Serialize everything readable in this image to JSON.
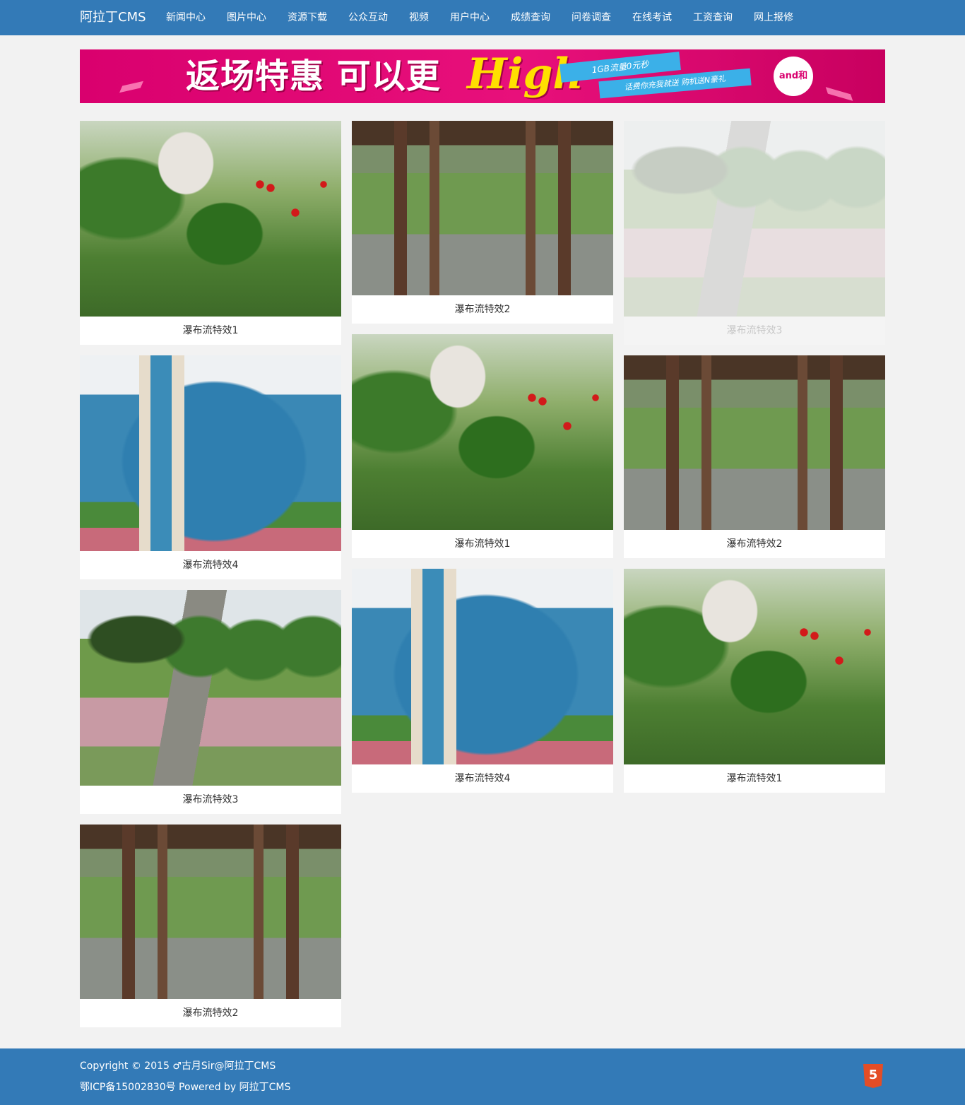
{
  "navbar": {
    "brand": "阿拉丁CMS",
    "items": [
      {
        "label": "新闻中心"
      },
      {
        "label": "图片中心"
      },
      {
        "label": "资源下载"
      },
      {
        "label": "公众互动"
      },
      {
        "label": "视频"
      },
      {
        "label": "用户中心"
      },
      {
        "label": "成绩查询"
      },
      {
        "label": "问卷调查"
      },
      {
        "label": "在线考试"
      },
      {
        "label": "工资查询"
      },
      {
        "label": "网上报修"
      }
    ]
  },
  "banner": {
    "headline": "返场特惠 可以更",
    "script_text": "High",
    "ribbon_top": "1GB流量0元秒",
    "ribbon_bottom": "话费你充我就送    购机送N豪礼",
    "logo_text": "and和"
  },
  "gallery": [
    {
      "caption": "瀑布流特效1",
      "scene": "rock"
    },
    {
      "caption": "瀑布流特效2",
      "scene": "corridor"
    },
    {
      "caption": "瀑布流特效3",
      "scene": "path",
      "faded": true
    },
    {
      "caption": "瀑布流特效4",
      "scene": "library"
    },
    {
      "caption": "瀑布流特效1",
      "scene": "rock"
    },
    {
      "caption": "瀑布流特效2",
      "scene": "corridor"
    },
    {
      "caption": "瀑布流特效3",
      "scene": "path"
    },
    {
      "caption": "瀑布流特效4",
      "scene": "library"
    },
    {
      "caption": "瀑布流特效1",
      "scene": "rock"
    },
    {
      "caption": "瀑布流特效2",
      "scene": "corridor"
    }
  ],
  "footer": {
    "copyright": "Copyright © 2015 ♂古月Sir@阿拉丁CMS",
    "icp": "鄂ICP备15002830号 Powered by 阿拉丁CMS",
    "badge_icon": "html5-icon",
    "badge_text": "5"
  },
  "colors": {
    "navbar": "#337ab7",
    "page_background": "#f2f2f2",
    "banner": "#e8107b"
  }
}
